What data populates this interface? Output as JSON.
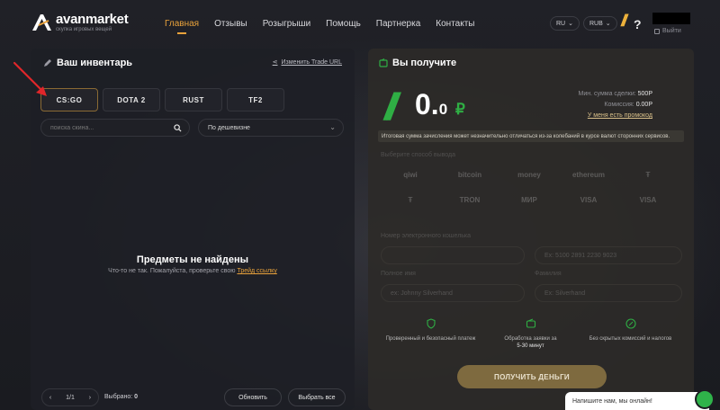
{
  "header": {
    "logo_title": "avanmarket",
    "logo_sub": "скупка игровых вещей",
    "nav": [
      "Главная",
      "Отзывы",
      "Розыгрыши",
      "Помощь",
      "Партнерка",
      "Контакты"
    ],
    "lang": "RU",
    "currency": "RUB",
    "logout": "Выйти"
  },
  "inventory": {
    "title": "Ваш инвентарь",
    "trade_url": "Изменить Trade URL",
    "games": [
      "CS:GO",
      "DOTA 2",
      "RUST",
      "TF2"
    ],
    "search_placeholder": "поиска скина...",
    "sort": "По дешевизне",
    "empty_title": "Предметы не найдены",
    "empty_sub": "Что-то не так. Пожалуйста, проверьте свою",
    "empty_link": "Трейд ссылку",
    "page": "1/1",
    "selected_label": "Выбрано:",
    "selected_count": "0",
    "refresh": "Обновить",
    "select_all": "Выбрать все"
  },
  "receive": {
    "title": "Вы получите",
    "amount_int": "0.",
    "amount_dec": "0",
    "currency_symbol": "₽",
    "min_label": "Мин. сумма сделки:",
    "min_value": "500Р",
    "fee_label": "Комиссия:",
    "fee_value": "0.00Р",
    "promo": "У меня есть промокод",
    "notice": "Итоговая сумма зачисления может незначительно отличаться из-за колебаний в курсе валют сторонних сервисов.",
    "methods_title": "Выберите способ вывода",
    "methods": [
      "qiwi",
      "bitcoin",
      "money",
      "ethereum",
      "",
      "",
      "TRON",
      "МИР",
      "VISA",
      "VISA"
    ],
    "label_wallet": "Номер электронного кошелька",
    "wallet_placeholder": "Ex: 5100 2891 2230 9023",
    "label_fullname": "Полное имя",
    "fullname_placeholder": "ex: Johnny Silverhand",
    "label_surname": "Фамилия",
    "surname_placeholder": "Ex: Silverhand",
    "feature1": "Проверенный и безопасный платеж",
    "feature2": "Обработка заявки за",
    "feature2b": "5-30 минут",
    "feature3": "Без скрытых комиссий и налогов",
    "button": "ПОЛУЧИТЬ ДЕНЬГИ"
  },
  "chat": {
    "text": "Напишите нам, мы онлайн!"
  },
  "colors": {
    "accent": "#e9a23b",
    "green": "#2fae44",
    "arrow": "#e0262a"
  }
}
